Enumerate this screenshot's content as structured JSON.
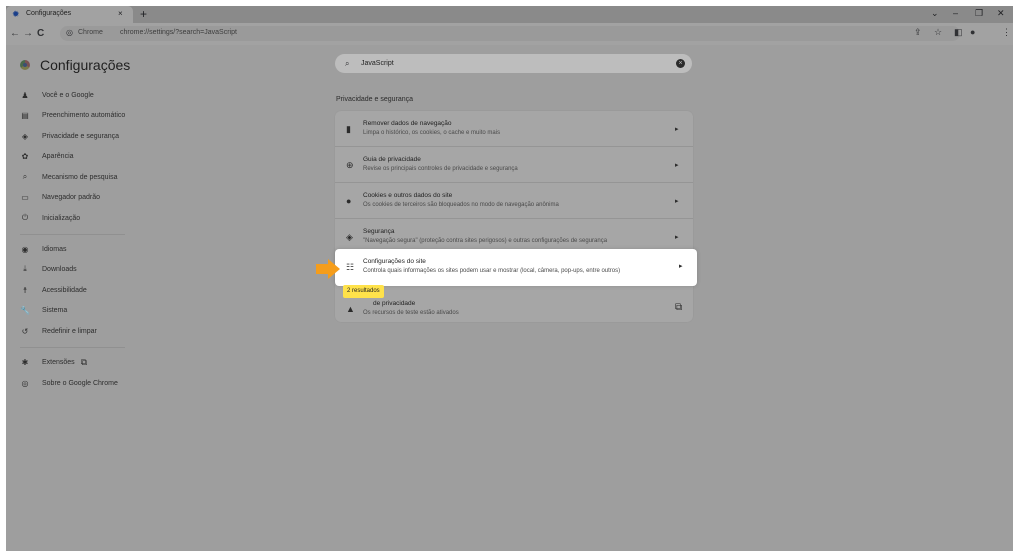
{
  "tab": {
    "title": "Configurações",
    "close": "×",
    "new_tab": "+"
  },
  "window_controls": [
    "⌄",
    "–",
    "❐",
    "✕"
  ],
  "toolbar": {
    "back": "←",
    "forward": "→",
    "reload": "C",
    "omnibox_prefix": "Chrome",
    "url": "chrome://settings/?search=JavaScript",
    "share": "⇪",
    "star": "☆",
    "sidepanel": "◧",
    "profile": "●",
    "menu": "⋮"
  },
  "page": {
    "title": "Configurações"
  },
  "sidebar": {
    "items": [
      {
        "label": "Você e o Google",
        "icon": "person-icon",
        "glyph": "♟"
      },
      {
        "label": "Preenchimento automático",
        "icon": "autofill-icon",
        "glyph": "▤"
      },
      {
        "label": "Privacidade e segurança",
        "icon": "shield-icon",
        "glyph": "◈"
      },
      {
        "label": "Aparência",
        "icon": "palette-icon",
        "glyph": "✿"
      },
      {
        "label": "Mecanismo de pesquisa",
        "icon": "search-icon",
        "glyph": "⌕"
      },
      {
        "label": "Navegador padrão",
        "icon": "browser-icon",
        "glyph": "▭"
      },
      {
        "label": "Inicialização",
        "icon": "power-icon",
        "glyph": "⏻"
      },
      {
        "label": "Idiomas",
        "icon": "globe-icon",
        "glyph": "◉"
      },
      {
        "label": "Downloads",
        "icon": "download-icon",
        "glyph": "⤓"
      },
      {
        "label": "Acessibilidade",
        "icon": "accessibility-icon",
        "glyph": "☨"
      },
      {
        "label": "Sistema",
        "icon": "wrench-icon",
        "glyph": "🔧"
      },
      {
        "label": "Redefinir e limpar",
        "icon": "reset-icon",
        "glyph": "↺"
      },
      {
        "label": "Extensões",
        "icon": "puzzle-icon",
        "glyph": "✱",
        "external": "⧉"
      },
      {
        "label": "Sobre o Google Chrome",
        "icon": "chrome-icon",
        "glyph": "◎"
      }
    ]
  },
  "search": {
    "value": "JavaScript",
    "clear": "×"
  },
  "section": {
    "title": "Privacidade e segurança"
  },
  "rows": [
    {
      "title": "Remover dados de navegação",
      "subtitle": "Limpa o histórico, os cookies, o cache e muito mais",
      "icon": "trash-icon",
      "glyph": "▮",
      "arrow": "▸"
    },
    {
      "title": "Guia de privacidade",
      "subtitle": "Revise os principais controles de privacidade e segurança",
      "icon": "privacy-guide-icon",
      "glyph": "⊕",
      "arrow": "▸"
    },
    {
      "title": "Cookies e outros dados do site",
      "subtitle": "Os cookies de terceiros são bloqueados no modo de navegação anônima",
      "icon": "cookie-icon",
      "glyph": "●",
      "arrow": "▸"
    },
    {
      "title": "Segurança",
      "subtitle": "\"Navegação segura\" (proteção contra sites perigosos) e outras configurações de segurança",
      "icon": "security-icon",
      "glyph": "◈",
      "arrow": "▸"
    }
  ],
  "highlight": {
    "title": "Configurações do site",
    "subtitle": "Controla quais informações os sites podem usar e mostrar (local, câmera, pop-ups, entre outros)",
    "icon": "tune-icon",
    "glyph": "☷",
    "arrow": "▸"
  },
  "last_row": {
    "title": "de privacidade",
    "subtitle": "Os recursos de teste estão ativados",
    "icon": "flask-icon",
    "glyph": "▲",
    "external": "⧉"
  },
  "badge": {
    "text": "2 resultados"
  },
  "colors": {
    "accent_orange": "#f59d1b",
    "badge_yellow": "#ffe24a"
  }
}
